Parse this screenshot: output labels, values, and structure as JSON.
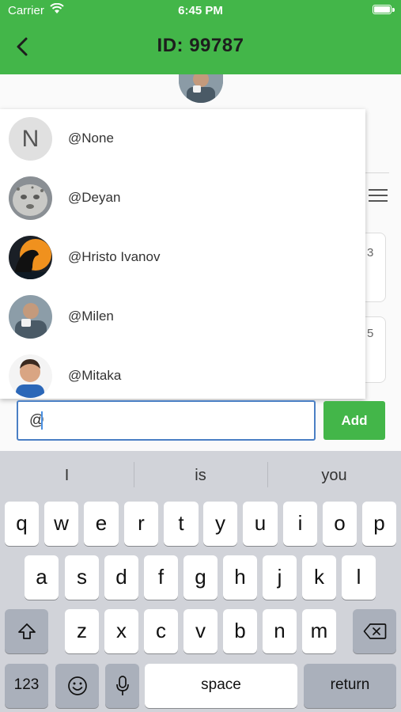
{
  "status_bar": {
    "carrier": "Carrier",
    "time": "6:45 PM"
  },
  "header": {
    "title": "ID: 99787"
  },
  "background_peeks": {
    "card1": "3",
    "card2": "5"
  },
  "mentions": [
    {
      "handle": "@None",
      "initial": "N"
    },
    {
      "handle": "@Deyan"
    },
    {
      "handle": "@Hristo Ivanov"
    },
    {
      "handle": "@Milen"
    },
    {
      "handle": "@Mitaka"
    }
  ],
  "composer": {
    "value": "@",
    "add_label": "Add"
  },
  "keyboard": {
    "suggestions": [
      "I",
      "is",
      "you"
    ],
    "row1": [
      "q",
      "w",
      "e",
      "r",
      "t",
      "y",
      "u",
      "i",
      "o",
      "p"
    ],
    "row2": [
      "a",
      "s",
      "d",
      "f",
      "g",
      "h",
      "j",
      "k",
      "l"
    ],
    "row3": [
      "z",
      "x",
      "c",
      "v",
      "b",
      "n",
      "m"
    ],
    "numbers_label": "123",
    "space_label": "space",
    "return_label": "return"
  },
  "colors": {
    "accent": "#43b649",
    "focus": "#4a7fc4"
  }
}
